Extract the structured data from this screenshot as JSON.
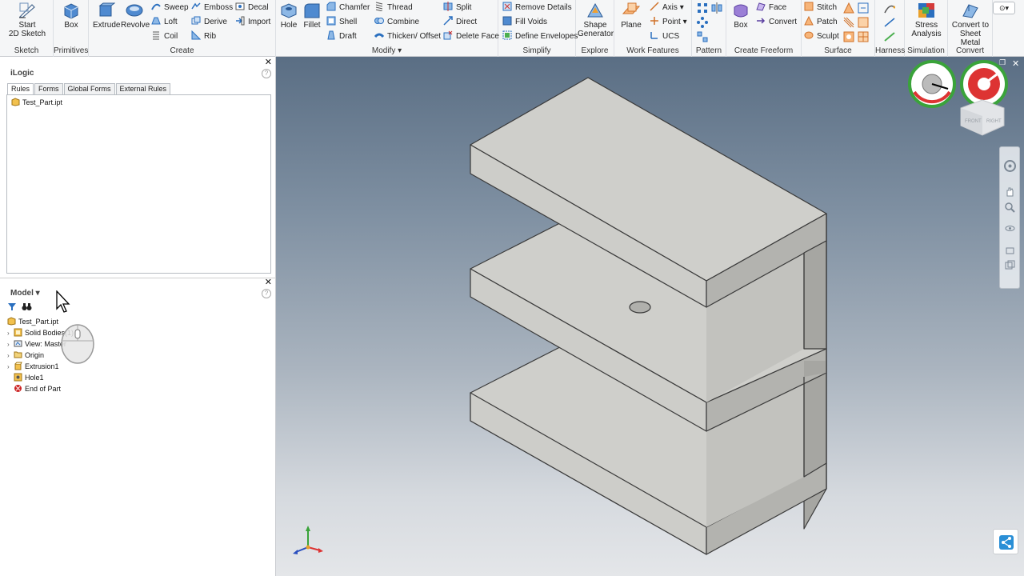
{
  "ribbon": {
    "sketch": {
      "start_label": "Start\n2D Sketch",
      "group": "Sketch"
    },
    "primitives": {
      "box_label": "Box",
      "group": "Primitives"
    },
    "create": {
      "extrude": "Extrude",
      "revolve": "Revolve",
      "sweep": "Sweep",
      "loft": "Loft",
      "coil": "Coil",
      "emboss": "Emboss",
      "derive": "Derive",
      "rib": "Rib",
      "decal": "Decal",
      "import": "Import",
      "group": "Create"
    },
    "modify": {
      "hole": "Hole",
      "fillet": "Fillet",
      "chamfer": "Chamfer",
      "shell": "Shell",
      "draft": "Draft",
      "thread": "Thread",
      "combine": "Combine",
      "thicken": "Thicken/ Offset",
      "split": "Split",
      "direct": "Direct",
      "delete_face": "Delete Face",
      "group": "Modify"
    },
    "simplify": {
      "remove_details": "Remove Details",
      "fill_voids": "Fill Voids",
      "define_envelopes": "Define Envelopes",
      "group": "Simplify"
    },
    "explore": {
      "shape_generator": "Shape\nGenerator",
      "group": "Explore"
    },
    "work_features": {
      "plane": "Plane",
      "axis": "Axis",
      "point": "Point",
      "ucs": "UCS",
      "group": "Work Features"
    },
    "pattern": {
      "group": "Pattern"
    },
    "freeform": {
      "box": "Box",
      "face": "Face",
      "convert": "Convert",
      "group": "Create Freeform"
    },
    "surface": {
      "stitch": "Stitch",
      "patch": "Patch",
      "sculpt": "Sculpt",
      "group": "Surface"
    },
    "harness": {
      "group": "Harness"
    },
    "simulation": {
      "stress": "Stress\nAnalysis",
      "group": "Simulation"
    },
    "convert": {
      "sheet_metal": "Convert to\nSheet Metal",
      "group": "Convert"
    }
  },
  "ilogic": {
    "title": "iLogic",
    "tabs": [
      "Rules",
      "Forms",
      "Global Forms",
      "External Rules"
    ],
    "active_tab": "Rules",
    "rule_item": "Test_Part.ipt"
  },
  "model": {
    "title": "Model",
    "tree": [
      {
        "label": "Test_Part.ipt",
        "icon": "part-icon"
      },
      {
        "label": "Solid Bodies(1)",
        "icon": "solid-bodies-icon"
      },
      {
        "label": "View: Master",
        "icon": "view-icon"
      },
      {
        "label": "Origin",
        "icon": "folder-icon"
      },
      {
        "label": "Extrusion1",
        "icon": "extrusion-icon"
      },
      {
        "label": "Hole1",
        "icon": "hole-icon"
      },
      {
        "label": "End of Part",
        "icon": "end-of-part-icon"
      }
    ]
  },
  "viewcube": {
    "front": "FRONT",
    "right": "RIGHT"
  },
  "colors": {
    "ribbon_bg": "#f5f6f7",
    "accent_blue": "#2a6fbf",
    "part_face": "#cfcfcb",
    "end_of_part": "#cc2222"
  }
}
